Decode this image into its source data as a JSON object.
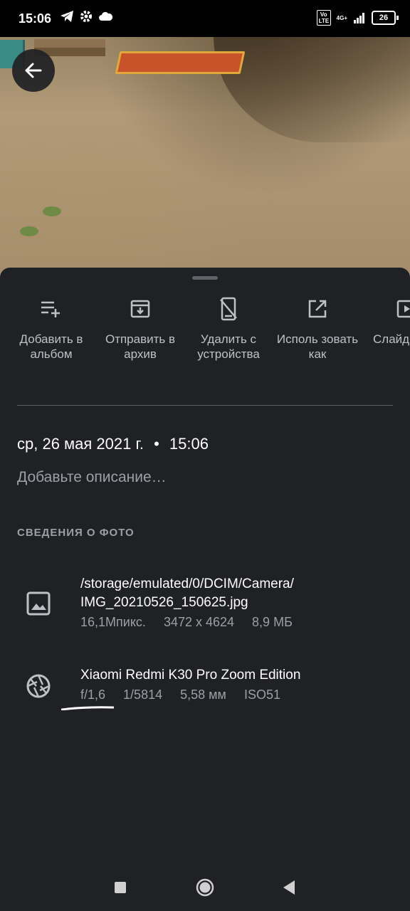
{
  "status_bar": {
    "time": "15:06",
    "network_volte": "Vo LTE",
    "network_type": "4G+",
    "battery": "26"
  },
  "actions": [
    {
      "label": "Добавить в альбом",
      "icon": "playlist-add-icon"
    },
    {
      "label": "Отправить в архив",
      "icon": "archive-icon"
    },
    {
      "label": "Удалить с устройства",
      "icon": "phone-delete-icon"
    },
    {
      "label": "Исполь зовать как",
      "icon": "open-in-new-icon"
    },
    {
      "label": "Слайд",
      "icon": "slideshow-icon"
    }
  ],
  "details": {
    "date": "ср, 26 мая 2021 г.",
    "separator": "•",
    "time": "15:06",
    "description_placeholder": "Добавьте описание…",
    "section_title": "СВЕДЕНИЯ О ФОТО",
    "file": {
      "path_line1": "/storage/emulated/0/DCIM/Camera/",
      "path_line2": "IMG_20210526_150625.jpg",
      "megapixels": "16,1Мпикс.",
      "resolution": "3472 x 4624",
      "size": "8,9 МБ"
    },
    "camera": {
      "model": "Xiaomi Redmi K30 Pro Zoom Edition",
      "aperture": "f/1,6",
      "shutter": "1/5814",
      "focal_length": "5,58 мм",
      "iso": "ISO51"
    }
  },
  "colors": {
    "background": "#202124",
    "text_primary": "#ffffff",
    "text_secondary": "#9aa0a6"
  }
}
